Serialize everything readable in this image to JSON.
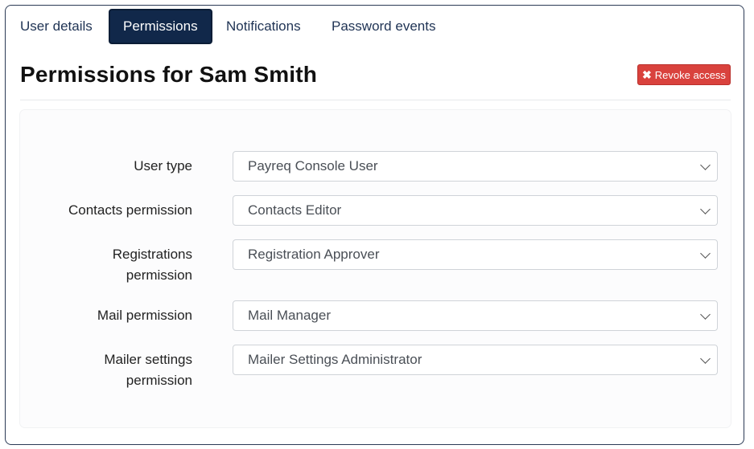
{
  "tabs": [
    {
      "label": "User details"
    },
    {
      "label": "Permissions"
    },
    {
      "label": "Notifications"
    },
    {
      "label": "Password events"
    }
  ],
  "active_tab": "Permissions",
  "title": "Permissions for Sam Smith",
  "revoke_button": {
    "label": "Revoke access",
    "icon": "x-icon",
    "color": "#d9423d"
  },
  "accent_color": "#11284a",
  "fields": [
    {
      "label": "User type",
      "value": "Payreq Console User"
    },
    {
      "label": "Contacts permission",
      "value": "Contacts Editor"
    },
    {
      "label_line1": "Registrations",
      "label_line2": "permission",
      "value": "Registration Approver"
    },
    {
      "label": "Mail permission",
      "value": "Mail Manager"
    },
    {
      "label_line1": "Mailer settings",
      "label_line2": "permission",
      "value": "Mailer Settings Administrator"
    }
  ]
}
